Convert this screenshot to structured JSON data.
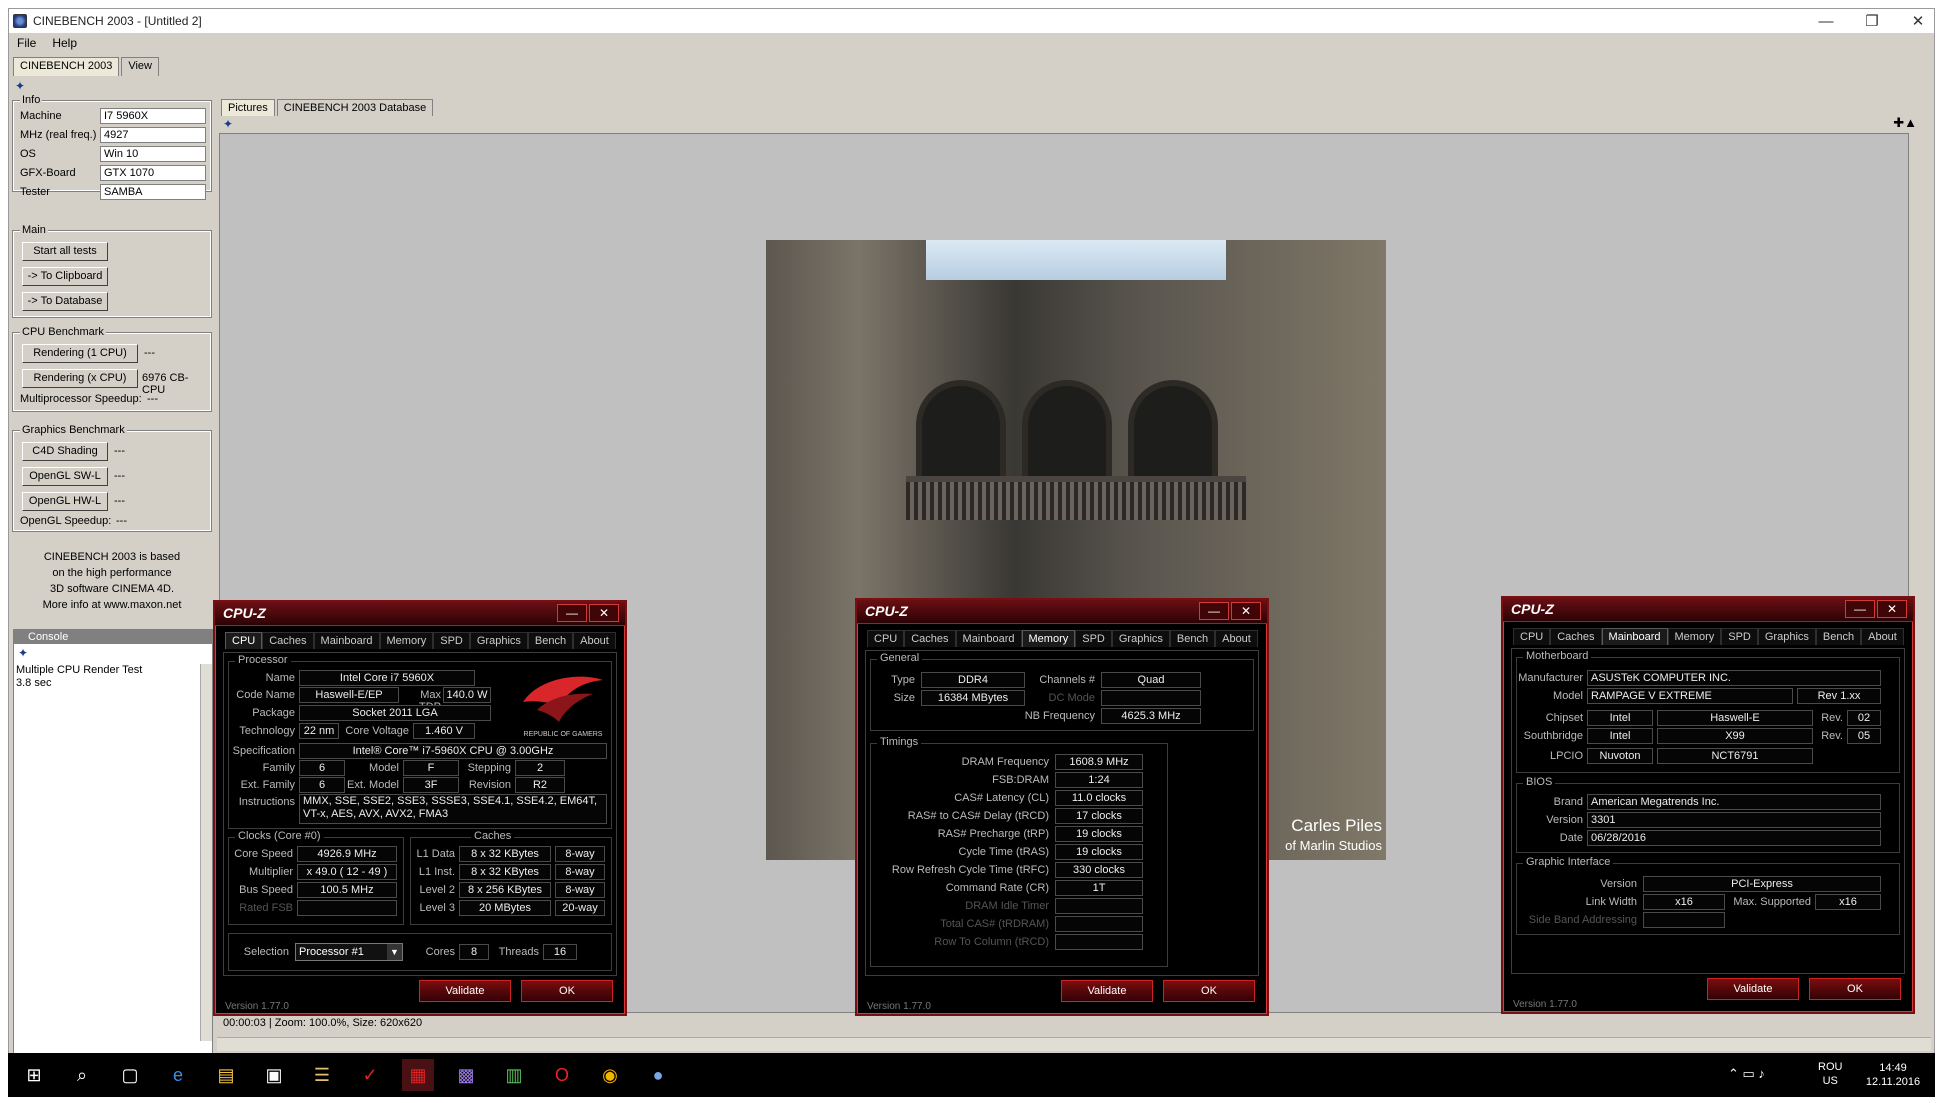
{
  "window": {
    "title": "CINEBENCH 2003 - [Untitled 2]"
  },
  "menu": [
    "File",
    "Help"
  ],
  "top_tabs": [
    "CINEBENCH 2003",
    "View"
  ],
  "info": {
    "label": "Info",
    "rows": [
      {
        "label": "Machine",
        "value": "I7 5960X"
      },
      {
        "label": "MHz (real freq.)",
        "value": "4927"
      },
      {
        "label": "OS",
        "value": "Win 10"
      },
      {
        "label": "GFX-Board",
        "value": "GTX 1070"
      },
      {
        "label": "Tester",
        "value": "SAMBA"
      }
    ]
  },
  "main": {
    "label": "Main",
    "buttons": [
      "Start all tests",
      "-> To Clipboard",
      "-> To Database"
    ]
  },
  "cpu_bench": {
    "label": "CPU Benchmark",
    "rows": [
      {
        "button": "Rendering (1 CPU)",
        "value": "---"
      },
      {
        "button": "Rendering (x CPU)",
        "value": "6976 CB-CPU"
      }
    ],
    "speedup_label": "Multiprocessor Speedup:",
    "speedup_value": "---"
  },
  "gfx_bench": {
    "label": "Graphics Benchmark",
    "rows": [
      {
        "button": "C4D Shading",
        "value": "---"
      },
      {
        "button": "OpenGL SW-L",
        "value": "---"
      },
      {
        "button": "OpenGL HW-L",
        "value": "---"
      }
    ],
    "speedup_label": "OpenGL Speedup:",
    "speedup_value": "---"
  },
  "about_text": [
    "CINEBENCH 2003 is based",
    "on the high performance",
    "3D software CINEMA 4D.",
    "More info at www.maxon.net"
  ],
  "console": {
    "label": "Console",
    "lines": [
      "Multiple CPU Render Test",
      "3.8 sec"
    ]
  },
  "pic_tabs": [
    "Pictures",
    "CINEBENCH 2003 Database"
  ],
  "render": {
    "credit1": "Carles Piles",
    "credit2": "of Marlin Studios"
  },
  "status": "00:00:03 | Zoom: 100.0%, Size: 620x620",
  "cpuz_tabs": [
    "CPU",
    "Caches",
    "Mainboard",
    "Memory",
    "SPD",
    "Graphics",
    "Bench",
    "About"
  ],
  "cpuz_title": "CPU-Z",
  "cpuz_version": "Version 1.77.0",
  "cpuz_buttons": {
    "validate": "Validate",
    "ok": "OK"
  },
  "cpuz1": {
    "processor_label": "Processor",
    "name_l": "Name",
    "name": "Intel Core i7 5960X",
    "code_l": "Code Name",
    "code": "Haswell-E/EP",
    "tdp_l": "Max TDP",
    "tdp": "140.0 W",
    "package_l": "Package",
    "package": "Socket 2011 LGA",
    "tech_l": "Technology",
    "tech": "22 nm",
    "volt_l": "Core Voltage",
    "volt": "1.460 V",
    "spec_l": "Specification",
    "spec": "Intel® Core™ i7-5960X CPU @ 3.00GHz",
    "family_l": "Family",
    "family": "6",
    "model_l": "Model",
    "model": "F",
    "stepping_l": "Stepping",
    "stepping": "2",
    "extfam_l": "Ext. Family",
    "extfam": "6",
    "extmod_l": "Ext. Model",
    "extmod": "3F",
    "rev_l": "Revision",
    "rev": "R2",
    "instr_l": "Instructions",
    "instr": "MMX, SSE, SSE2, SSE3, SSSE3, SSE4.1, SSE4.2, EM64T, VT-x, AES, AVX, AVX2, FMA3",
    "clocks_label": "Clocks (Core #0)",
    "caches_label": "Caches",
    "clocks": [
      {
        "l": "Core Speed",
        "v": "4926.9 MHz"
      },
      {
        "l": "Multiplier",
        "v": "x 49.0 ( 12 - 49 )"
      },
      {
        "l": "Bus Speed",
        "v": "100.5 MHz"
      },
      {
        "l": "Rated FSB",
        "v": ""
      }
    ],
    "caches": [
      {
        "l": "L1 Data",
        "v": "8 x 32 KBytes",
        "w": "8-way"
      },
      {
        "l": "L1 Inst.",
        "v": "8 x 32 KBytes",
        "w": "8-way"
      },
      {
        "l": "Level 2",
        "v": "8 x 256 KBytes",
        "w": "8-way"
      },
      {
        "l": "Level 3",
        "v": "20 MBytes",
        "w": "20-way"
      }
    ],
    "selection_l": "Selection",
    "selection": "Processor #1",
    "cores_l": "Cores",
    "cores": "8",
    "threads_l": "Threads",
    "threads": "16",
    "logo_text": "REPUBLIC OF GAMERS"
  },
  "cpuz2": {
    "general_label": "General",
    "type_l": "Type",
    "type": "DDR4",
    "channels_l": "Channels #",
    "channels": "Quad",
    "size_l": "Size",
    "size": "16384 MBytes",
    "dc_l": "DC Mode",
    "dc": "",
    "nb_l": "NB Frequency",
    "nb": "4625.3 MHz",
    "timings_label": "Timings",
    "timings": [
      {
        "l": "DRAM Frequency",
        "v": "1608.9 MHz"
      },
      {
        "l": "FSB:DRAM",
        "v": "1:24"
      },
      {
        "l": "CAS# Latency (CL)",
        "v": "11.0 clocks"
      },
      {
        "l": "RAS# to CAS# Delay (tRCD)",
        "v": "17 clocks"
      },
      {
        "l": "RAS# Precharge (tRP)",
        "v": "19 clocks"
      },
      {
        "l": "Cycle Time (tRAS)",
        "v": "19 clocks"
      },
      {
        "l": "Row Refresh Cycle Time (tRFC)",
        "v": "330 clocks"
      },
      {
        "l": "Command Rate (CR)",
        "v": "1T"
      },
      {
        "l": "DRAM Idle Timer",
        "v": ""
      },
      {
        "l": "Total CAS# (tRDRAM)",
        "v": ""
      },
      {
        "l": "Row To Column (tRCD)",
        "v": ""
      }
    ]
  },
  "cpuz3": {
    "mb_label": "Motherboard",
    "mfr_l": "Manufacturer",
    "mfr": "ASUSTeK COMPUTER INC.",
    "model_l": "Model",
    "model": "RAMPAGE V EXTREME",
    "model_rev": "Rev 1.xx",
    "chipset_l": "Chipset",
    "chipset": "Intel",
    "chipset2": "Haswell-E",
    "rev_l": "Rev.",
    "chipset_rev": "02",
    "south_l": "Southbridge",
    "south": "Intel",
    "south2": "X99",
    "south_rev": "05",
    "lpcio_l": "LPCIO",
    "lpcio": "Nuvoton",
    "lpcio2": "NCT6791",
    "bios_label": "BIOS",
    "brand_l": "Brand",
    "brand": "American Megatrends Inc.",
    "version_l": "Version",
    "version": "3301",
    "date_l": "Date",
    "date": "06/28/2016",
    "gi_label": "Graphic Interface",
    "gver_l": "Version",
    "gver": "PCI-Express",
    "lw_l": "Link Width",
    "lw": "x16",
    "maxs_l": "Max. Supported",
    "maxs": "x16",
    "sba_l": "Side Band Addressing",
    "sba": ""
  },
  "tray": {
    "lang1": "ROU",
    "lang2": "US",
    "time": "14:49",
    "date": "12.11.2016"
  },
  "colors": {
    "accent": "#b01a1f",
    "bg": "#d4d0c8"
  }
}
